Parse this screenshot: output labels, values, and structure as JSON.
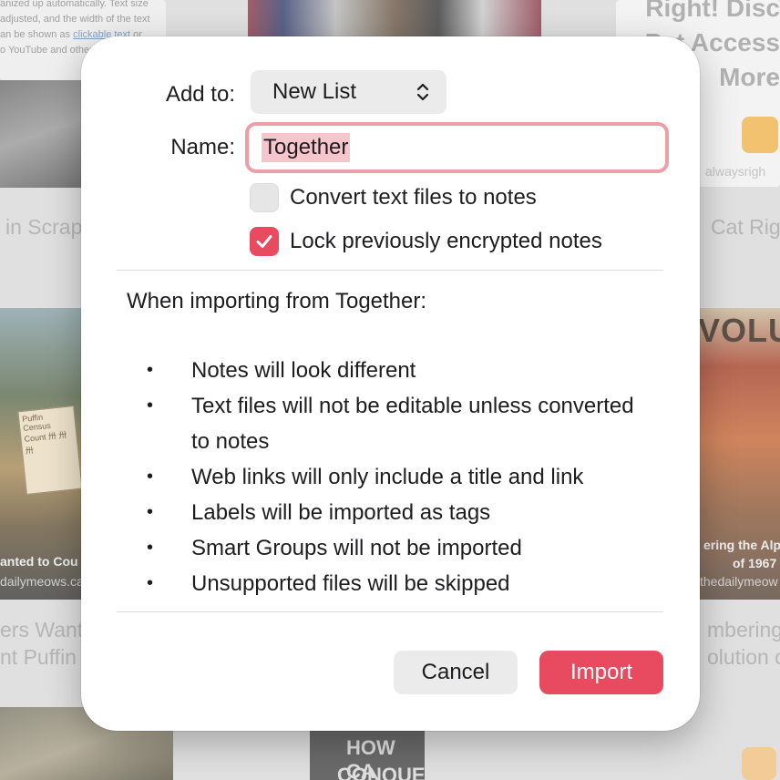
{
  "background": {
    "card_top_left_text": [
      "anized up automatically. Text size",
      "adjusted, and the width of the text",
      "an be shown as",
      "clickable text",
      " or",
      "o YouTube and other vi"
    ],
    "title_left_1": "in Scrap",
    "title_right_1": "Cat Rig",
    "bigtitle_right": [
      "Right! Disc",
      "Pet Access",
      "More"
    ],
    "site_right": "alwaysrigh",
    "img_left_caption": "anted to Cou",
    "img_left_site": "dailymeows.ca",
    "img_left_sign": [
      "Puffin Census",
      "Count  卅 卅 卅"
    ],
    "img_right_top": "VOLU",
    "img_right_caption": [
      "ering the Alp",
      "of 1967"
    ],
    "img_right_site": "thedailymeow",
    "title_left_2": [
      "ers Want",
      "nt Puffin"
    ],
    "title_right_2": [
      "mbering t",
      "olution o"
    ],
    "poster_bottom": [
      "HOW CA",
      "CONQUE"
    ]
  },
  "dialog": {
    "add_to_label": "Add to:",
    "add_to_value": "New List",
    "name_label": "Name:",
    "name_value": "Together",
    "options": [
      {
        "label": "Convert text files to notes",
        "checked": false
      },
      {
        "label": "Lock previously encrypted notes",
        "checked": true
      }
    ],
    "intro": "When importing from Together:",
    "bullet_char": "•",
    "bullets": [
      "Notes will look different",
      "Text files will not be editable unless converted to notes",
      "Web links will only include a title and link",
      "Labels will be imported as tags",
      "Smart Groups will not be imported",
      "Unsupported files will be skipped"
    ],
    "cancel_label": "Cancel",
    "import_label": "Import"
  },
  "colors": {
    "accent": "#e84a5f",
    "field_ring": "#eba0a8",
    "selection": "#f6c6cc"
  }
}
